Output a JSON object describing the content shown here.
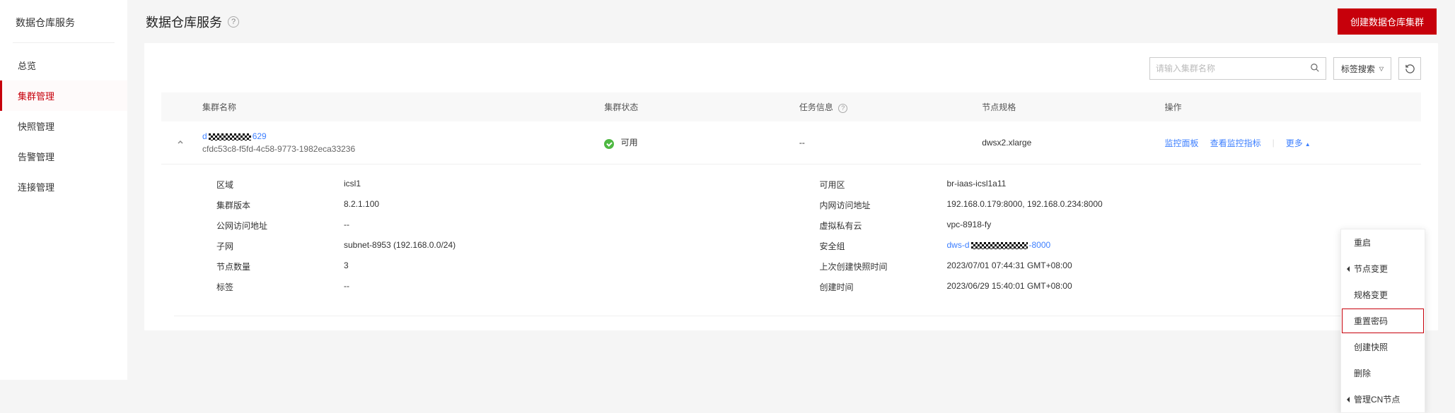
{
  "sidebar": {
    "title": "数据仓库服务",
    "items": [
      {
        "label": "总览"
      },
      {
        "label": "集群管理"
      },
      {
        "label": "快照管理"
      },
      {
        "label": "告警管理"
      },
      {
        "label": "连接管理"
      }
    ]
  },
  "header": {
    "title": "数据仓库服务",
    "create_btn": "创建数据仓库集群"
  },
  "toolbar": {
    "search_placeholder": "请输入集群名称",
    "tag_search": "标签搜索"
  },
  "table": {
    "headers": {
      "name": "集群名称",
      "status": "集群状态",
      "task": "任务信息",
      "spec": "节点规格",
      "ops": "操作"
    },
    "row": {
      "name_prefix": "d",
      "name_suffix": "629",
      "id": "cfdc53c8-f5fd-4c58-9773-1982eca33236",
      "status": "可用",
      "task": "--",
      "spec": "dwsx2.xlarge",
      "action_monitor": "监控面板",
      "action_metrics": "查看监控指标",
      "action_more": "更多"
    }
  },
  "details": {
    "left": {
      "region_label": "区域",
      "region_value": "icsl1",
      "version_label": "集群版本",
      "version_value": "8.2.1.100",
      "public_label": "公网访问地址",
      "public_value": "--",
      "subnet_label": "子网",
      "subnet_value": "subnet-8953 (192.168.0.0/24)",
      "nodes_label": "节点数量",
      "nodes_value": "3",
      "tags_label": "标签",
      "tags_value": "--"
    },
    "right": {
      "az_label": "可用区",
      "az_value": "br-iaas-icsl1a11",
      "intranet_label": "内网访问地址",
      "intranet_value": "192.168.0.179:8000, 192.168.0.234:8000",
      "vpc_label": "虚拟私有云",
      "vpc_value": "vpc-8918-fy",
      "sg_label": "安全组",
      "sg_value_prefix": "dws-d",
      "sg_value_suffix": "-8000",
      "last_snap_label": "上次创建快照时间",
      "last_snap_value": "2023/07/01 07:44:31 GMT+08:00",
      "created_label": "创建时间",
      "created_value": "2023/06/29 15:40:01 GMT+08:00"
    }
  },
  "menu": {
    "restart": "重启",
    "node_change": "节点变更",
    "spec_change": "规格变更",
    "reset_password": "重置密码",
    "create_snapshot": "创建快照",
    "delete": "删除",
    "manage_cn": "管理CN节点"
  }
}
